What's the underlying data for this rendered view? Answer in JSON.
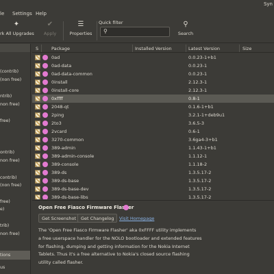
{
  "window": {
    "title": "Syn"
  },
  "menu": {
    "items": [
      "le",
      "Settings",
      "Help"
    ]
  },
  "toolbar": {
    "mark_all_upgrades": "rk All Upgrades",
    "apply": "Apply",
    "properties": "Properties",
    "filter_label": "Quick filter",
    "filter_value": "",
    "search": "Search"
  },
  "sidebar": {
    "items": [
      "(contrib)",
      "(non free)",
      "ntrib)",
      "non free)",
      "free)",
      "ontrib)",
      "non free)",
      "contrib)",
      "(non free)",
      "free)",
      "e)",
      "trib)",
      "non free)",
      "tions",
      "us"
    ],
    "selected_label": "tions"
  },
  "table": {
    "headers": {
      "status": "S",
      "package": "Package",
      "installed": "Installed Version",
      "latest": "Latest Version",
      "size": "Size"
    },
    "rows": [
      {
        "name": "0ad",
        "installed": "",
        "latest": "0.0.23-1+b1"
      },
      {
        "name": "0ad-data",
        "installed": "",
        "latest": "0.0.23-1"
      },
      {
        "name": "0ad-data-common",
        "installed": "",
        "latest": "0.0.23-1"
      },
      {
        "name": "0install",
        "installed": "",
        "latest": "2.12.3-1"
      },
      {
        "name": "0install-core",
        "installed": "",
        "latest": "2.12.3-1"
      },
      {
        "name": "0xffff",
        "installed": "",
        "latest": "0.8-1"
      },
      {
        "name": "2048-qt",
        "installed": "",
        "latest": "0.1.6-1+b1"
      },
      {
        "name": "2ping",
        "installed": "",
        "latest": "3.2.1-1+deb9u1"
      },
      {
        "name": "2to3",
        "installed": "",
        "latest": "3.6.5-3"
      },
      {
        "name": "2vcard",
        "installed": "",
        "latest": "0.6-1"
      },
      {
        "name": "3270-common",
        "installed": "",
        "latest": "3.6ga4-3+b1"
      },
      {
        "name": "389-admin",
        "installed": "",
        "latest": "1.1.43-1+b1"
      },
      {
        "name": "389-admin-console",
        "installed": "",
        "latest": "1.1.12-1"
      },
      {
        "name": "389-console",
        "installed": "",
        "latest": "1.1.18-2"
      },
      {
        "name": "389-ds",
        "installed": "",
        "latest": "1.3.5.17-2"
      },
      {
        "name": "389-ds-base",
        "installed": "",
        "latest": "1.3.5.17-2"
      },
      {
        "name": "389-ds-base-dev",
        "installed": "",
        "latest": "1.3.5.17-2"
      },
      {
        "name": "389-ds-base-libs",
        "installed": "",
        "latest": "1.3.5.17-2"
      }
    ],
    "selected_row": "0xffff"
  },
  "details": {
    "title": "Open Free Fiasco Firmware Flasher",
    "get_screenshot": "Get Screenshot",
    "get_changelog": "Get Changelog",
    "homepage": "Visit Homepage",
    "description": "The 'Open Free Fiasco Firmware Flasher' aka 0xFFFF utility implements\na free userspace handler for the NOLO bootloader and extended features\nfor flashing, dumping and getting information for the Nokia Internet\nTablets. Thus it's a free alternative to Nokia's closed source flashing\nutility called flasher."
  },
  "colors": {
    "background": "#3c3b37",
    "selection": "#5b5a54",
    "text": "#dfdbd2",
    "link": "#8ab4e8",
    "support_badge": "#e27ad0"
  }
}
